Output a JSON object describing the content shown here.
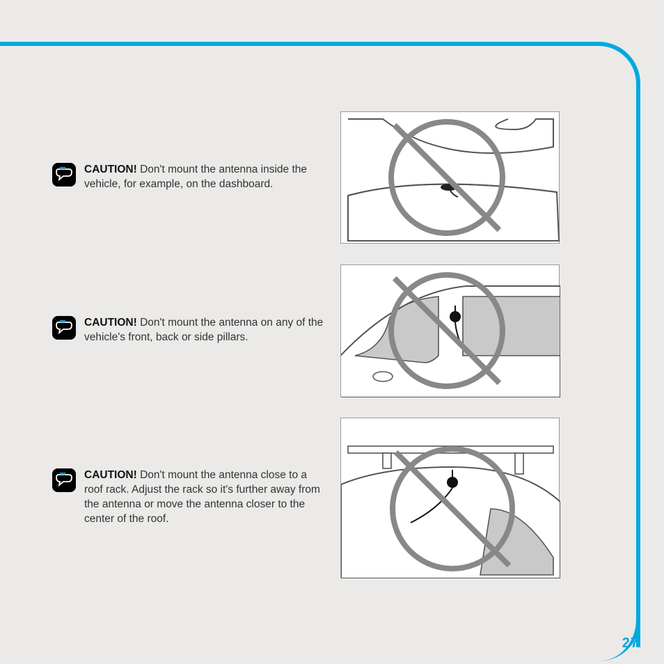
{
  "cautions": [
    {
      "label": "CAUTION!",
      "text": " Don't mount the antenna inside the vehicle, for example, on the dashboard."
    },
    {
      "label": "CAUTION!",
      "text": " Don't mount the antenna on any of the vehicle's front, back or side pillars."
    },
    {
      "label": "CAUTION!",
      "text": " Don't mount the antenna close to a roof rack. Adjust the rack so it's further away from the antenna or move the antenna closer to the center of the roof."
    }
  ],
  "page_number": "27"
}
